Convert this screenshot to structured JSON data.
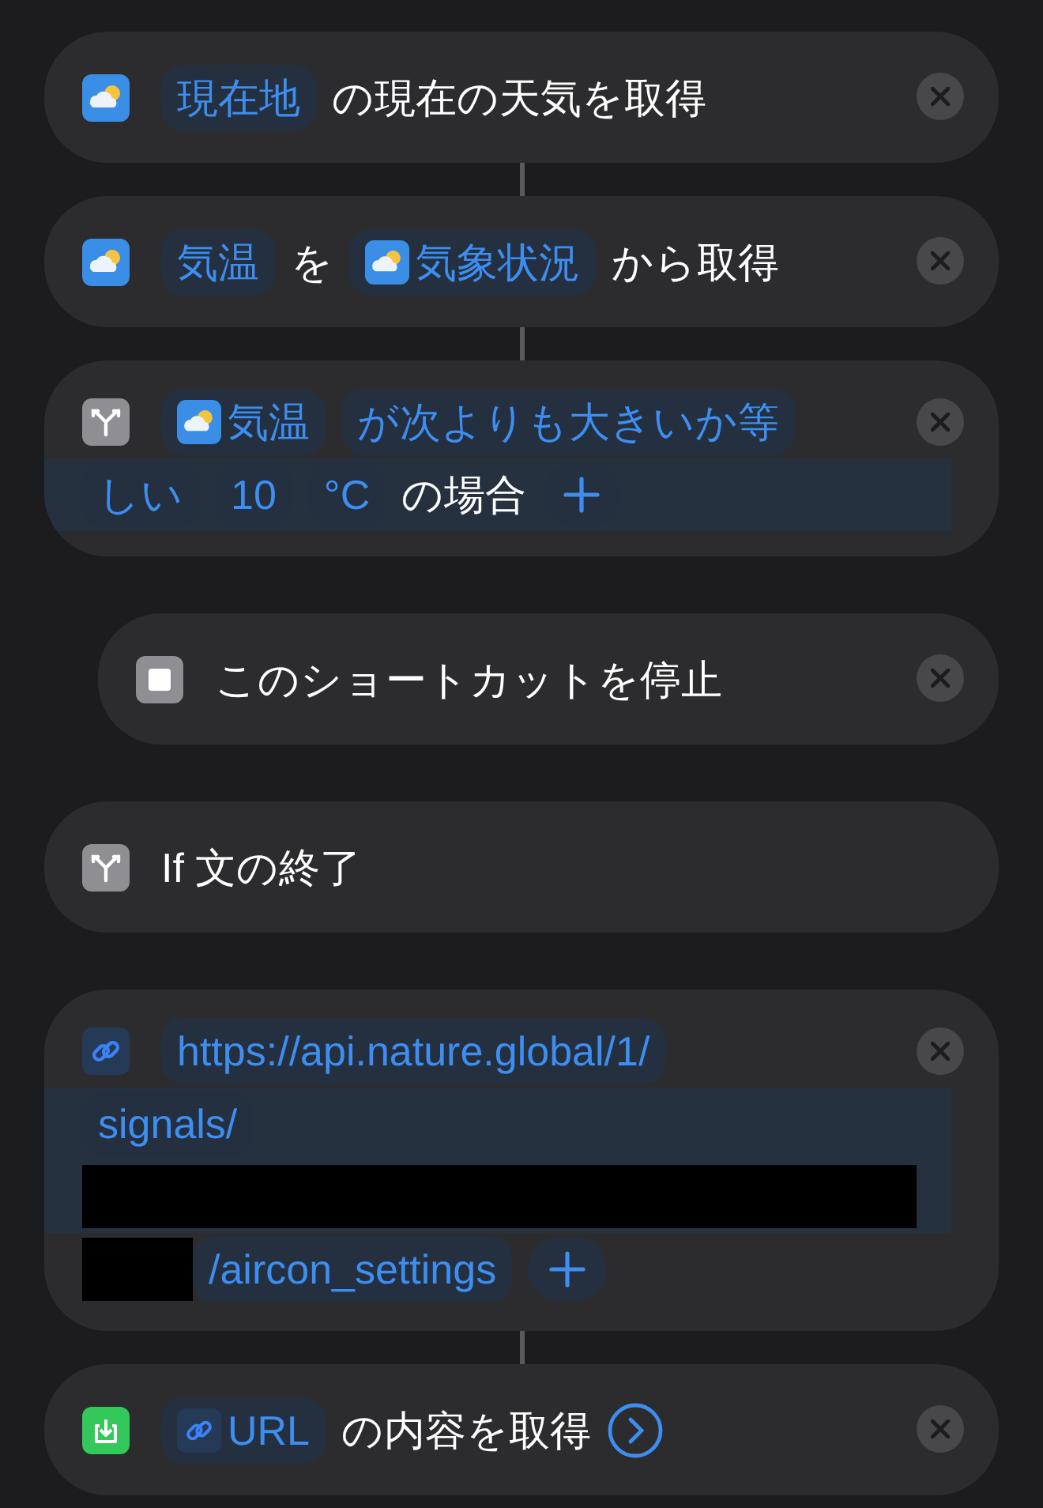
{
  "actions": [
    {
      "kind": "weather",
      "indent": false,
      "connector": false,
      "removable": true,
      "lines": [
        {
          "band": false,
          "parts": [
            {
              "kind": "token",
              "text": "現在地"
            },
            {
              "kind": "text",
              "text": "の現在の天気を取得"
            }
          ]
        }
      ]
    },
    {
      "kind": "weather",
      "indent": false,
      "connector": true,
      "removable": true,
      "lines": [
        {
          "band": false,
          "parts": [
            {
              "kind": "token",
              "text": "気温"
            },
            {
              "kind": "text",
              "text": "を"
            },
            {
              "kind": "weathertoken",
              "text": "気象状況"
            },
            {
              "kind": "text",
              "text": "から取得"
            }
          ]
        }
      ]
    },
    {
      "kind": "branch",
      "indent": false,
      "connector": true,
      "removable": true,
      "lines": [
        {
          "band": false,
          "parts": [
            {
              "kind": "weathertoken",
              "text": "気温"
            },
            {
              "kind": "token",
              "text": "が次よりも大きいか等"
            }
          ]
        },
        {
          "band": true,
          "parts": [
            {
              "kind": "token",
              "text": "しい"
            },
            {
              "kind": "token",
              "text": "10"
            },
            {
              "kind": "token",
              "text": "°C"
            },
            {
              "kind": "text",
              "text": "の場合"
            },
            {
              "kind": "plus"
            }
          ]
        }
      ]
    },
    {
      "kind": "stop",
      "indent": true,
      "connector": false,
      "removable": true,
      "lines": [
        {
          "band": false,
          "parts": [
            {
              "kind": "text",
              "text": "このショートカットを停止"
            }
          ]
        }
      ]
    },
    {
      "kind": "branch",
      "indent": false,
      "connector": false,
      "removable": false,
      "lines": [
        {
          "band": false,
          "parts": [
            {
              "kind": "text",
              "text": "If 文の終了"
            }
          ]
        }
      ]
    },
    {
      "kind": "link",
      "indent": false,
      "connector": false,
      "removable": true,
      "lines": [
        {
          "band": false,
          "parts": [
            {
              "kind": "token",
              "text": "https://api.nature.global/1/"
            }
          ]
        },
        {
          "band": true,
          "parts": [
            {
              "kind": "token",
              "text": "signals/"
            }
          ]
        },
        {
          "band": true,
          "parts": [
            {
              "kind": "redaction"
            }
          ]
        },
        {
          "band": false,
          "parts": [
            {
              "kind": "redaction"
            },
            {
              "kind": "token",
              "text": "/aircon_settings"
            },
            {
              "kind": "plus"
            }
          ]
        }
      ]
    },
    {
      "kind": "download",
      "indent": false,
      "connector": true,
      "removable": true,
      "lines": [
        {
          "band": false,
          "parts": [
            {
              "kind": "linktoken",
              "text": "URL"
            },
            {
              "kind": "text",
              "text": "の内容を取得"
            },
            {
              "kind": "chevron"
            }
          ]
        }
      ]
    }
  ]
}
